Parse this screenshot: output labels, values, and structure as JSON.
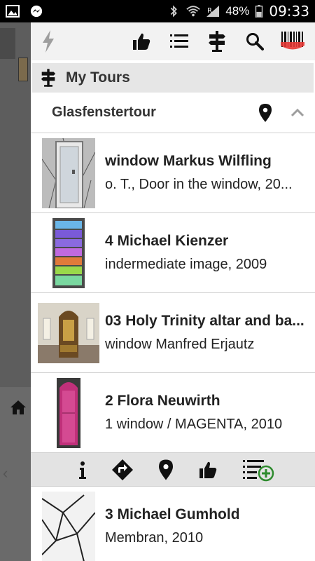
{
  "status": {
    "battery": "48%",
    "time": "09:33"
  },
  "toolbar": {
    "icons": [
      "flash-icon",
      "thumbs-up-icon",
      "list-icon",
      "signpost-icon",
      "search-icon",
      "barcode-scanner-icon"
    ]
  },
  "section": {
    "title": "My Tours"
  },
  "tour": {
    "name": "Glasfenstertour"
  },
  "items": [
    {
      "title": "window Markus Wilfling",
      "subtitle": "o. T., Door in the window, 20..."
    },
    {
      "title": "4 Michael Kienzer",
      "subtitle": "indermediate image, 2009"
    },
    {
      "title": "03 Holy Trinity altar and ba...",
      "subtitle": "window Manfred  Erjautz"
    },
    {
      "title": "2 Flora Neuwirth",
      "subtitle": "1 window / MAGENTA, 2010"
    },
    {
      "title": "3 Michael Gumhold",
      "subtitle": "Membran, 2010"
    }
  ],
  "actions": [
    "info-icon",
    "directions-icon",
    "location-pin-icon",
    "thumbs-up-icon",
    "add-to-list-icon"
  ],
  "colors": {
    "accent_green": "#2e8b2e",
    "barcode_red": "#e53935"
  }
}
